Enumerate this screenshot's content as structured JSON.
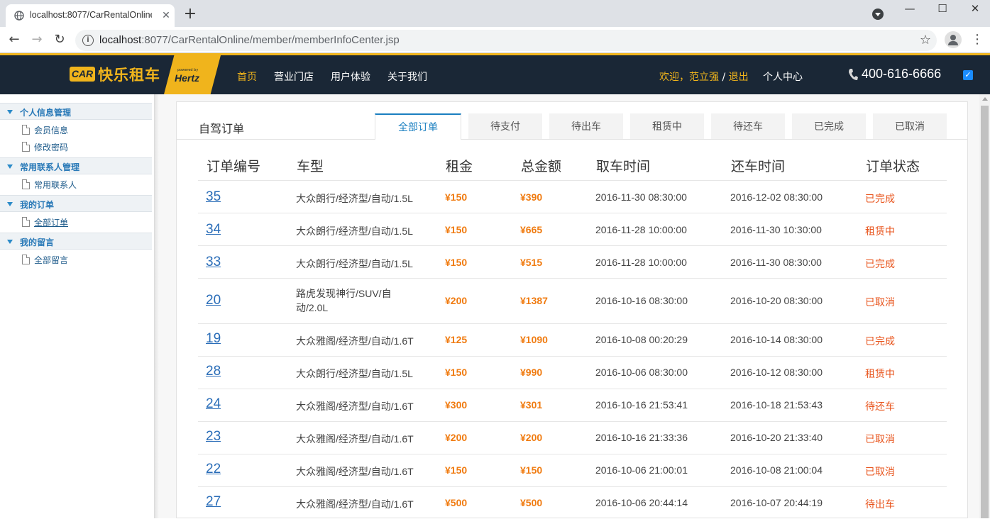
{
  "browser": {
    "tab_title": "localhost:8077/CarRentalOnline",
    "url_host": "localhost",
    "url_rest": ":8077/CarRentalOnline/member/memberInfoCenter.jsp"
  },
  "header": {
    "logo_car": "CAR",
    "logo_text": "快乐租车",
    "hertz_powered": "powered by",
    "hertz_text": "Hertz",
    "nav": [
      "首页",
      "营业门店",
      "用户体验",
      "关于我们"
    ],
    "welcome": "欢迎，范立强",
    "logout": "退出",
    "personal_center": "个人中心",
    "phone": "400-616-6666",
    "accent_color": "#f0b41c",
    "bg_color": "#1a2736"
  },
  "sidebar": {
    "groups": [
      {
        "title": "个人信息管理",
        "items": [
          "会员信息",
          "修改密码"
        ]
      },
      {
        "title": "常用联系人管理",
        "items": [
          "常用联系人"
        ]
      },
      {
        "title": "我的订单",
        "items": [
          "全部订单"
        ]
      },
      {
        "title": "我的留言",
        "items": [
          "全部留言"
        ]
      }
    ]
  },
  "panel": {
    "title": "自驾订单",
    "tabs": [
      "全部订单",
      "待支付",
      "待出车",
      "租赁中",
      "待还车",
      "已完成",
      "已取消"
    ],
    "active_tab": "全部订单",
    "columns": [
      "订单编号",
      "车型",
      "租金",
      "总金额",
      "取车时间",
      "还车时间",
      "订单状态"
    ],
    "orders": [
      {
        "id": "35",
        "model": "大众朗行/经济型/自动/1.5L",
        "rent": "¥150",
        "total": "¥390",
        "pickup": "2016-11-30 08:30:00",
        "return": "2016-12-02 08:30:00",
        "status": "已完成"
      },
      {
        "id": "34",
        "model": "大众朗行/经济型/自动/1.5L",
        "rent": "¥150",
        "total": "¥665",
        "pickup": "2016-11-28 10:00:00",
        "return": "2016-11-30 10:30:00",
        "status": "租赁中"
      },
      {
        "id": "33",
        "model": "大众朗行/经济型/自动/1.5L",
        "rent": "¥150",
        "total": "¥515",
        "pickup": "2016-11-28 10:00:00",
        "return": "2016-11-30 08:30:00",
        "status": "已完成"
      },
      {
        "id": "20",
        "model": "路虎发现神行/SUV/自动/2.0L",
        "rent": "¥200",
        "total": "¥1387",
        "pickup": "2016-10-16 08:30:00",
        "return": "2016-10-20 08:30:00",
        "status": "已取消"
      },
      {
        "id": "19",
        "model": "大众雅阁/经济型/自动/1.6T",
        "rent": "¥125",
        "total": "¥1090",
        "pickup": "2016-10-08 00:20:29",
        "return": "2016-10-14 08:30:00",
        "status": "已完成"
      },
      {
        "id": "28",
        "model": "大众朗行/经济型/自动/1.5L",
        "rent": "¥150",
        "total": "¥990",
        "pickup": "2016-10-06 08:30:00",
        "return": "2016-10-12 08:30:00",
        "status": "租赁中"
      },
      {
        "id": "24",
        "model": "大众雅阁/经济型/自动/1.6T",
        "rent": "¥300",
        "total": "¥301",
        "pickup": "2016-10-16 21:53:41",
        "return": "2016-10-18 21:53:43",
        "status": "待还车"
      },
      {
        "id": "23",
        "model": "大众雅阁/经济型/自动/1.6T",
        "rent": "¥200",
        "total": "¥200",
        "pickup": "2016-10-16 21:33:36",
        "return": "2016-10-20 21:33:40",
        "status": "已取消"
      },
      {
        "id": "22",
        "model": "大众雅阁/经济型/自动/1.6T",
        "rent": "¥150",
        "total": "¥150",
        "pickup": "2016-10-06 21:00:01",
        "return": "2016-10-08 21:00:04",
        "status": "已取消"
      },
      {
        "id": "27",
        "model": "大众雅阁/经济型/自动/1.6T",
        "rent": "¥500",
        "total": "¥500",
        "pickup": "2016-10-06 20:44:14",
        "return": "2016-10-07 20:44:19",
        "status": "待出车"
      }
    ]
  }
}
